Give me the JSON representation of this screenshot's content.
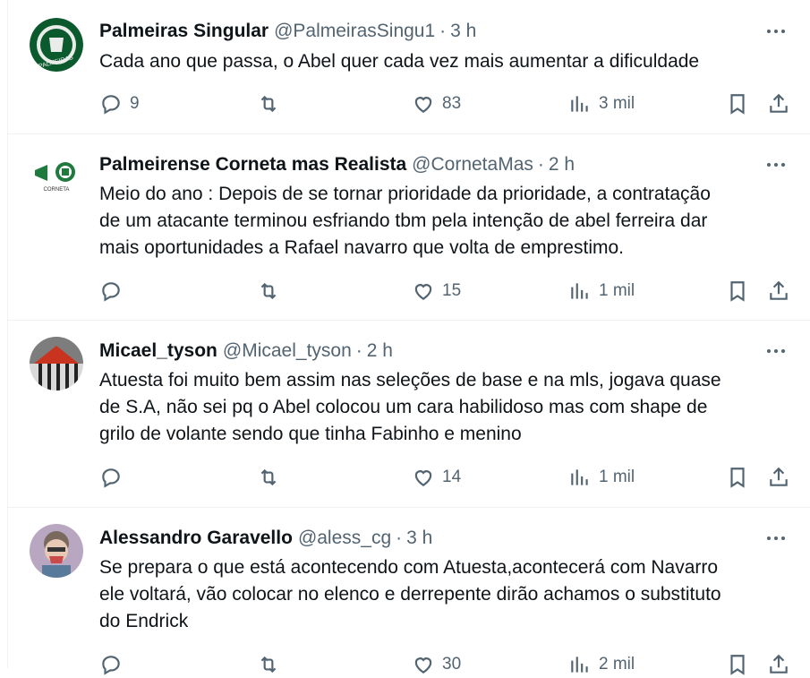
{
  "tweets": [
    {
      "name": "Palmeiras Singular",
      "handle": "@PalmeirasSingu1",
      "time": "3 h",
      "lines": [
        "Cada ano que passa, o Abel quer cada vez mais aumentar a dificuldade"
      ],
      "replies": "9",
      "retweets": "",
      "likes": "83",
      "views": "3 mil",
      "avatar_colors": [
        "#0b5a2e",
        "#e9ece9"
      ]
    },
    {
      "name": "Palmeirense Corneta mas Realista",
      "handle": "@CornetaMas",
      "time": "2 h",
      "lines": [
        "Meio do ano : Depois de se tornar prioridade da prioridade, a contratação",
        "de um atacante terminou esfriando tbm pela intenção de abel ferreira dar",
        "mais oportunidades a Rafael navarro que volta de emprestimo."
      ],
      "replies": "",
      "retweets": "",
      "likes": "15",
      "views": "1 mil",
      "avatar_colors": [
        "#1f7a3d",
        "#ffffff"
      ]
    },
    {
      "name": "Micael_tyson",
      "handle": "@Micael_tyson",
      "time": "2 h",
      "lines": [
        "Atuesta foi muito bem assim nas seleções de base e na mls, jogava quase",
        "de S.A, não sei pq o Abel colocou um cara habilidoso mas com shape de",
        "grilo de volante sendo que tinha Fabinho e menino"
      ],
      "replies": "",
      "retweets": "",
      "likes": "14",
      "views": "1 mil",
      "avatar_colors": [
        "#c8341f",
        "#d9d9d9"
      ]
    },
    {
      "name": "Alessandro Garavello",
      "handle": "@aless_cg",
      "time": "3 h",
      "lines": [
        "Se prepara o que está acontecendo com Atuesta,acontecerá com Navarro",
        "ele voltará, vão colocar no elenco e derrepente dirão achamos o substituto",
        "do Endrick"
      ],
      "replies": "",
      "retweets": "",
      "likes": "30",
      "views": "2 mil",
      "avatar_colors": [
        "#8a6a9b",
        "#c94a4a"
      ]
    }
  ],
  "icons": {
    "reply": "reply-icon",
    "retweet": "retweet-icon",
    "like": "heart-icon",
    "views": "views-icon",
    "bookmark": "bookmark-icon",
    "share": "share-icon",
    "more": "more-icon"
  }
}
